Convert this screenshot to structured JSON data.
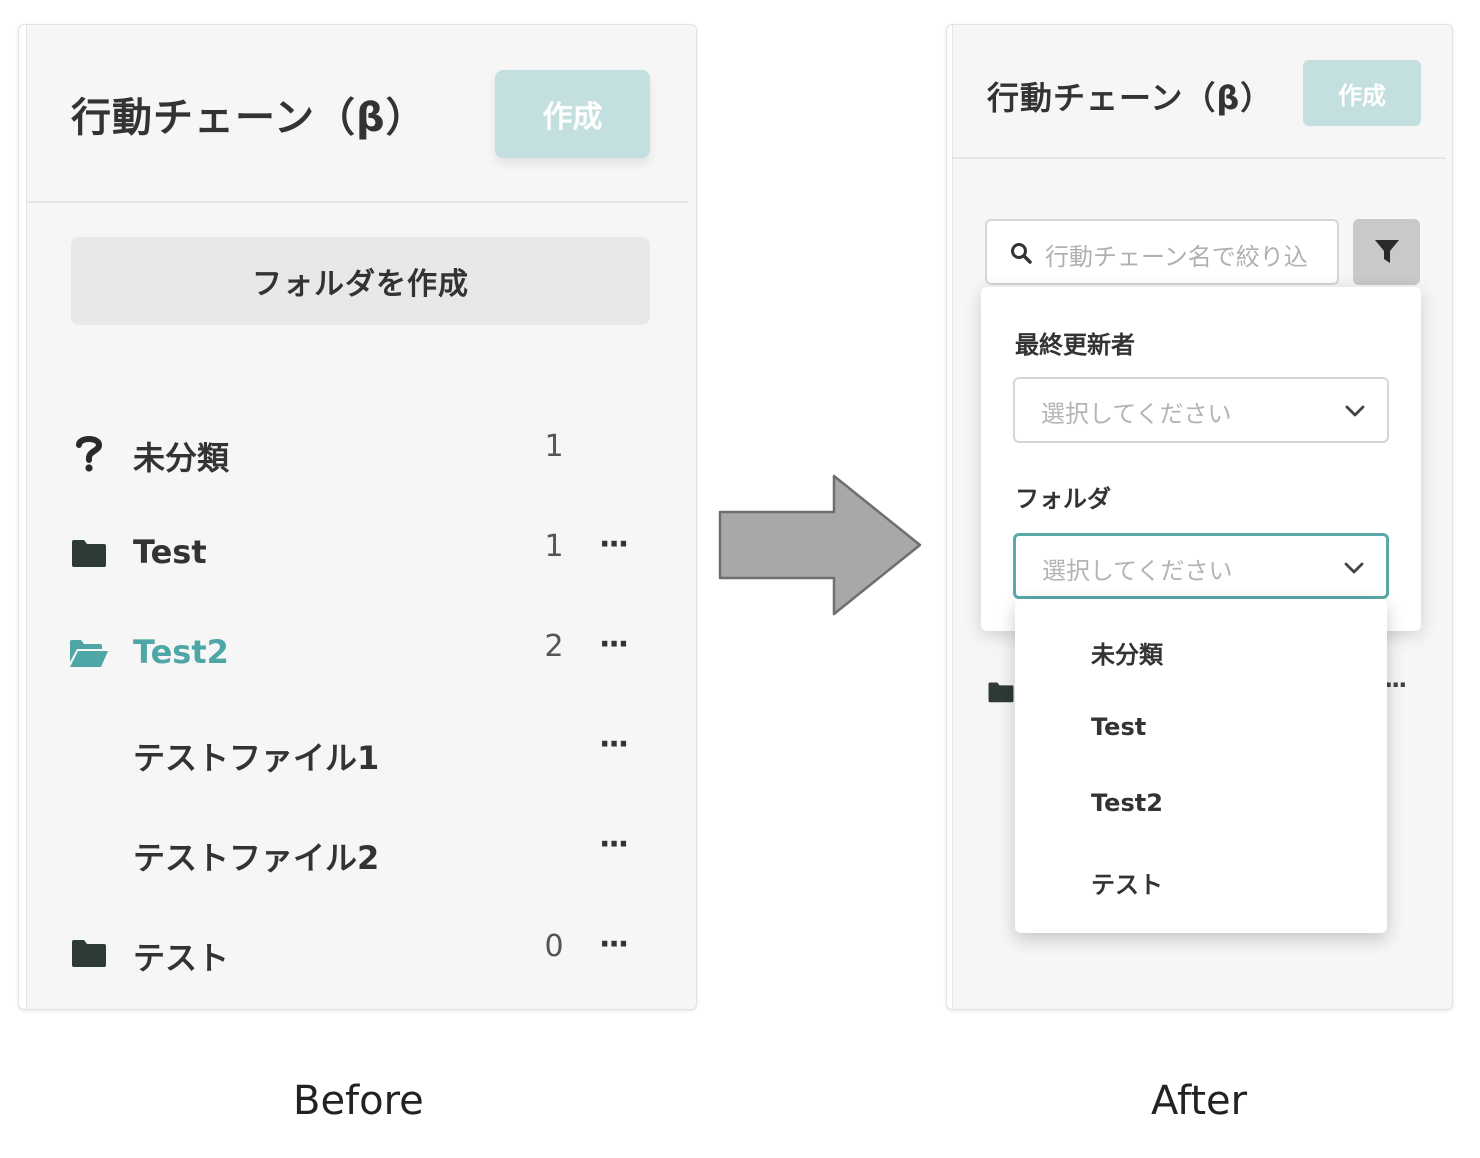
{
  "before": {
    "title": "行動チェーン（β）",
    "create_label": "作成",
    "folder_create_label": "フォルダを作成",
    "items": [
      {
        "icon": "question-icon",
        "label": "未分類",
        "count": "1",
        "more": ""
      },
      {
        "icon": "folder-icon",
        "label": "Test",
        "count": "1",
        "more": "···"
      },
      {
        "icon": "folder-open-icon",
        "label": "Test2",
        "count": "2",
        "more": "···"
      },
      {
        "icon": "",
        "label": "テストファイル1",
        "count": "",
        "more": "···"
      },
      {
        "icon": "",
        "label": "テストファイル2",
        "count": "",
        "more": "···"
      },
      {
        "icon": "folder-icon",
        "label": "テスト",
        "count": "0",
        "more": "···"
      }
    ]
  },
  "after": {
    "title": "行動チェーン（β）",
    "create_label": "作成",
    "search_placeholder": "行動チェーン名で絞り込",
    "filter": {
      "updater_label": "最終更新者",
      "updater_placeholder": "選択してください",
      "folder_label": "フォルダ",
      "folder_placeholder": "選択してください"
    },
    "background_more": "···",
    "folder_options": [
      "未分類",
      "Test",
      "Test2",
      "テスト"
    ]
  },
  "captions": {
    "before": "Before",
    "after": "After"
  },
  "colors": {
    "accent": "#4ea6a6",
    "create_button": "#c4dfdf",
    "panel_bg": "#f6f6f6",
    "folder_icon": "#2e3a38",
    "arrow_fill": "#a8a8a8"
  }
}
